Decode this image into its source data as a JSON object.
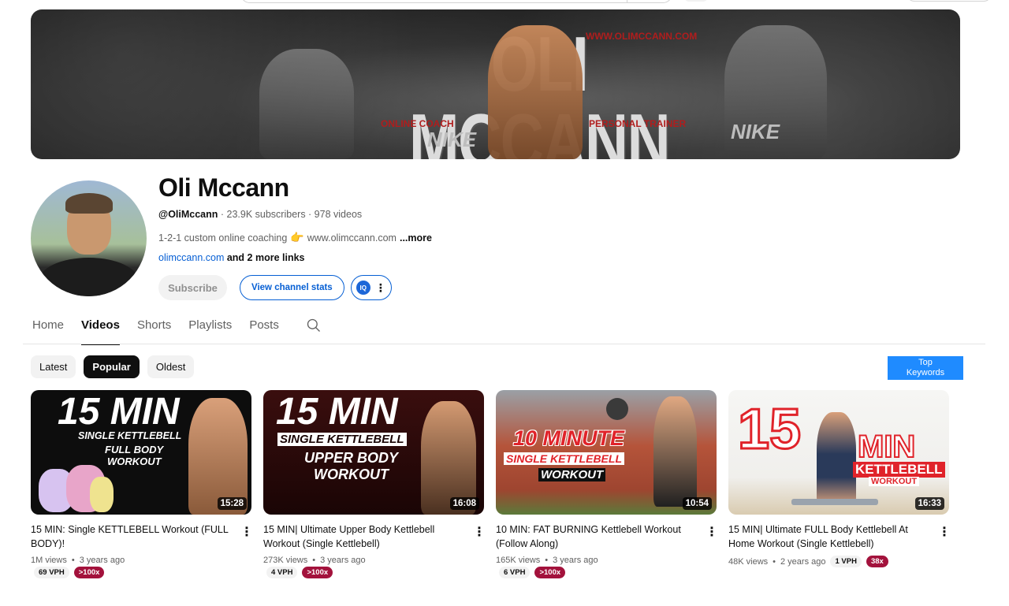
{
  "banner": {
    "title": "OLI MCCANN",
    "website": "WWW.OLIMCCANN.COM",
    "left_tag": "ONLINE COACH",
    "right_tag": "PERSONAL TRAINER",
    "brand_mark": "NIKE"
  },
  "channel": {
    "name": "Oli Mccann",
    "handle": "@OliMccann",
    "subscribers": " · 23.9K subscribers",
    "videos": " · 978 videos",
    "description": "1-2-1 custom online coaching",
    "description_link": "www.olimccann.com",
    "more_label": "...more",
    "link": "olimccann.com",
    "more_links": " and 2 more links",
    "subscribe_label": "Subscribe",
    "stats_label": "View channel stats",
    "ext_logo": "IQ"
  },
  "tabs": [
    {
      "label": "Home",
      "active": false
    },
    {
      "label": "Videos",
      "active": true
    },
    {
      "label": "Shorts",
      "active": false
    },
    {
      "label": "Playlists",
      "active": false
    },
    {
      "label": "Posts",
      "active": false
    }
  ],
  "chips": [
    {
      "label": "Latest",
      "active": false
    },
    {
      "label": "Popular",
      "active": true
    },
    {
      "label": "Oldest",
      "active": false
    }
  ],
  "top_keywords": {
    "line1": "Top",
    "line2": "Keywords"
  },
  "videos": [
    {
      "thumb_big": "15 MIN",
      "thumb_sub1": "SINGLE KETTLEBELL",
      "thumb_sub2": "FULL BODY",
      "thumb_sub3": "WORKOUT",
      "duration": "15:28",
      "title": "15 MIN: Single KETTLEBELL Workout (FULL BODY)!",
      "views": "1M views",
      "age": "3 years ago",
      "vph": "69 VPH",
      "ratio": ">100x"
    },
    {
      "thumb_big": "15 MIN",
      "thumb_sub1": "SINGLE KETTLEBELL",
      "thumb_sub2": "UPPER BODY",
      "thumb_sub3": "WORKOUT",
      "duration": "16:08",
      "title": "15 MIN| Ultimate Upper Body Kettlebell Workout (Single Kettlebell)",
      "views": "273K views",
      "age": "3 years ago",
      "vph": "4 VPH",
      "ratio": ">100x"
    },
    {
      "thumb_big": "10 MINUTE",
      "thumb_sub1": "SINGLE KETTLEBELL",
      "thumb_sub2": "WORKOUT",
      "thumb_sub3": "",
      "duration": "10:54",
      "title": "10 MIN: FAT BURNING Kettlebell Workout (Follow Along)",
      "views": "165K views",
      "age": "3 years ago",
      "vph": "6 VPH",
      "ratio": ">100x"
    },
    {
      "thumb_big": "15",
      "thumb_sub1": "MIN",
      "thumb_sub2": "KETTLEBELL",
      "thumb_sub3": "WORKOUT",
      "duration": "16:33",
      "title": "15 MIN| Ultimate FULL Body Kettlebell At Home Workout (Single Kettlebell)",
      "views": "48K views",
      "age": "2 years ago",
      "vph": "1 VPH",
      "ratio": "38x"
    }
  ],
  "separators": {
    "dot": "•"
  },
  "colors": {
    "link_blue": "#065fd4",
    "ratio_red": "#a3123c",
    "keywords_blue": "#1f8bff"
  }
}
